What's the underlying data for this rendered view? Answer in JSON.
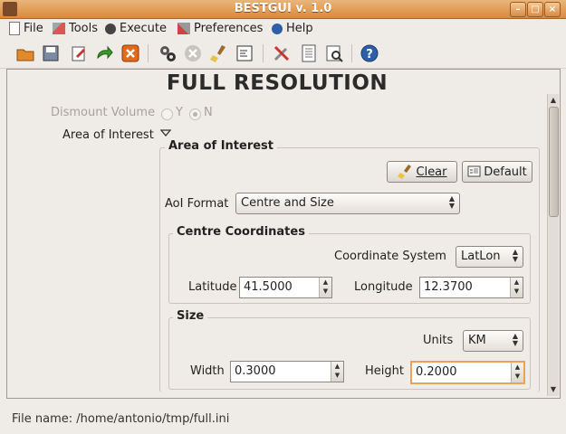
{
  "window": {
    "title": "BESTGUI v. 1.0"
  },
  "menu": [
    {
      "label": "File",
      "icon": "file-icon"
    },
    {
      "label": "Tools",
      "icon": "tools-icon"
    },
    {
      "label": "Execute",
      "icon": "gear-icon"
    },
    {
      "label": "Preferences",
      "icon": "preferences-icon"
    },
    {
      "label": "Help",
      "icon": "help-icon"
    }
  ],
  "toolbar": [
    "open-folder-icon",
    "save-icon",
    "edit-icon",
    "redo-icon",
    "close-icon",
    "run-gears-icon",
    "stop-icon",
    "clear-broom-icon",
    "console-icon",
    "tools-icon",
    "list-icon",
    "inspect-icon",
    "help-icon"
  ],
  "page": {
    "heading": "FULL RESOLUTION"
  },
  "form": {
    "dismount_label": "Dismount Volume",
    "dismount_y": "Y",
    "dismount_n": "N",
    "aoi_label": "Area of Interest",
    "aoi_group_title": "Area of Interest",
    "clear_label": "Clear",
    "default_label": "Default",
    "aoi_format_label": "AoI Format",
    "aoi_format_value": "Centre and Size",
    "centre_title": "Centre Coordinates",
    "coord_sys_label": "Coordinate System",
    "coord_sys_value": "LatLon",
    "latitude_label": "Latitude",
    "latitude_value": "41.5000",
    "longitude_label": "Longitude",
    "longitude_value": "12.3700",
    "size_title": "Size",
    "units_label": "Units",
    "units_value": "KM",
    "width_label": "Width",
    "width_value": "0.3000",
    "height_label": "Height",
    "height_value": "0.2000"
  },
  "status": {
    "text": "File name: /home/antonio/tmp/full.ini"
  },
  "colors": {
    "titlebar": "#d98a3c",
    "window_bg": "#efebe7",
    "focus": "#e8a35c"
  }
}
